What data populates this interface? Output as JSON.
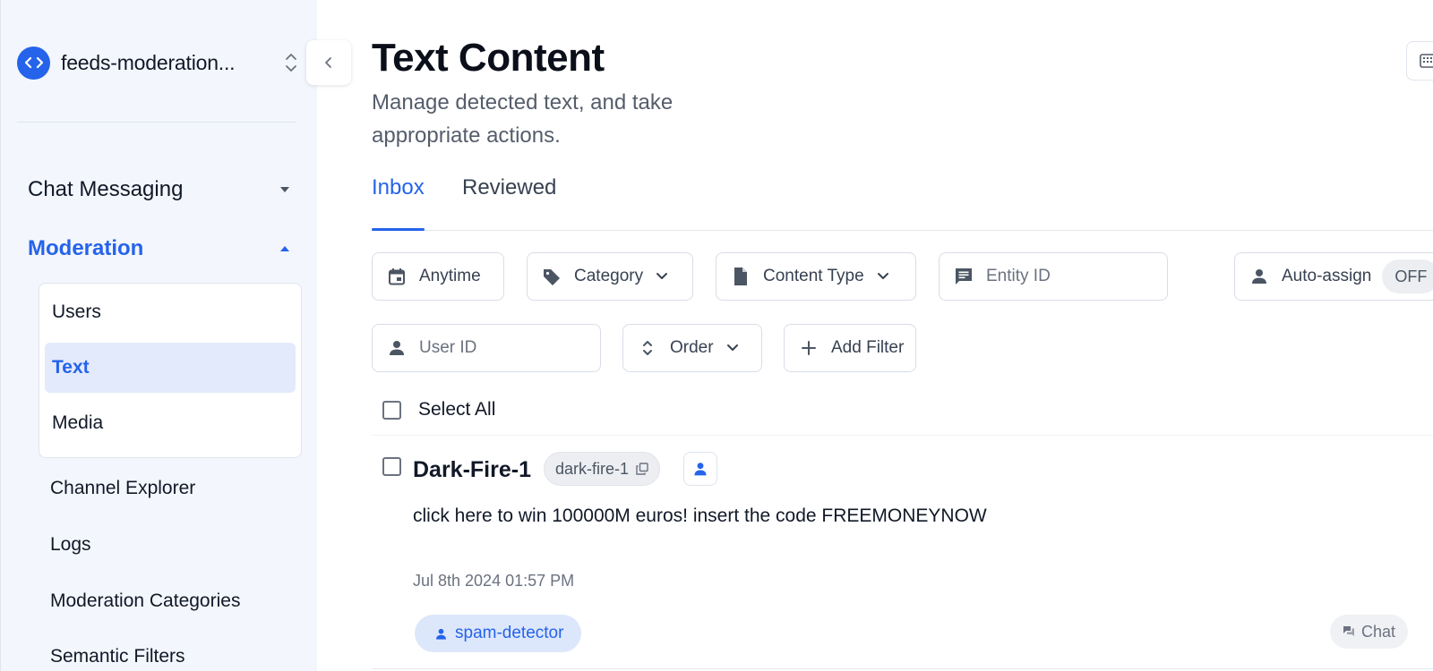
{
  "sidebar": {
    "project_name": "feeds-moderation...",
    "sections": {
      "chat": "Chat Messaging",
      "moderation": "Moderation"
    },
    "moderation_items": [
      "Users",
      "Text",
      "Media"
    ],
    "links": [
      "Channel Explorer",
      "Logs",
      "Moderation Categories",
      "Semantic Filters"
    ]
  },
  "header": {
    "title": "Text Content",
    "subtitle": "Manage detected text, and take appropriate actions."
  },
  "tabs": [
    "Inbox",
    "Reviewed"
  ],
  "filters": {
    "anytime": "Anytime",
    "category": "Category",
    "content_type": "Content Type",
    "entity_id": "Entity ID",
    "auto_assign": "Auto-assign",
    "auto_assign_state": "OFF",
    "user_id": "User ID",
    "order": "Order",
    "add_filter": "Add Filter"
  },
  "select_all": "Select All",
  "item": {
    "user": "Dark-Fire-1",
    "user_id": "dark-fire-1",
    "message": "click here to win 100000M euros! insert the code FREEMONEYNOW",
    "timestamp": "Jul 8th 2024 01:57 PM",
    "tag": "spam-detector",
    "source": "Chat"
  },
  "colors": {
    "accent": "#2563eb",
    "sidebar_bg": "#f3f6fc",
    "active_item_bg": "#e3eafb",
    "tag_bg": "#dde7fb"
  }
}
